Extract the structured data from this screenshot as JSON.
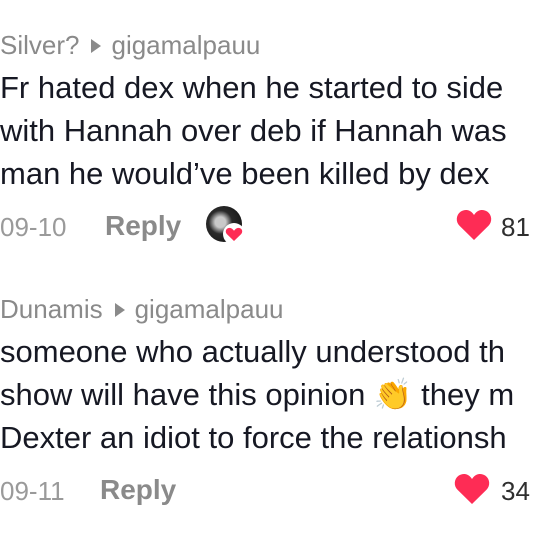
{
  "comments": [
    {
      "author": "Silver?",
      "reply_to": "gigamalpauu",
      "lines": [
        "Fr hated dex when he started to side",
        "with Hannah over deb if Hannah was",
        "man he would’ve been killed by dex"
      ],
      "date": "09-10",
      "reply_label": "Reply",
      "likes": "81"
    },
    {
      "author": "Dunamis",
      "reply_to": "gigamalpauu",
      "lines": [
        "someone who actually understood th",
        "show will have this opinion 👏 they m",
        "Dexter an idiot to force the relationsh"
      ],
      "date": "09-11",
      "reply_label": "Reply",
      "likes": "34"
    }
  ],
  "colors": {
    "like": "#fe2c55",
    "meta": "#8a8a8a",
    "text": "#161823"
  },
  "icons": {
    "reply_arrow": "triangle-right-icon",
    "like": "heart-icon",
    "avatar_badge": "heart-icon"
  }
}
